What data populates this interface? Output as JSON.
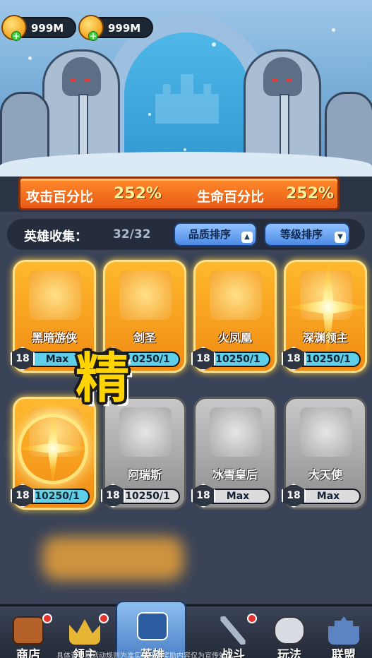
{
  "currency": [
    {
      "icon": "gold-gem-icon",
      "value": "999M"
    },
    {
      "icon": "gold-coin-icon",
      "value": "999M"
    }
  ],
  "stats": {
    "attack_label": "攻击百分比",
    "attack_value": "252%",
    "hp_label": "生命百分比",
    "hp_value": "252%"
  },
  "collection": {
    "label": "英雄收集：",
    "count": "32/32",
    "sort_quality": "品质排序",
    "sort_level": "等级排序"
  },
  "overlay_text": "精",
  "heroes": [
    {
      "name": "黑暗游侠",
      "level": "18",
      "progress_text": "Max",
      "rarity": "gold",
      "icon": "dark-ranger-icon",
      "progress": 1.0
    },
    {
      "name": "剑圣",
      "level": "18",
      "progress_text": "10250/1",
      "rarity": "gold",
      "icon": "sword-saint-icon",
      "progress": 1.0
    },
    {
      "name": "火凤凰",
      "level": "18",
      "progress_text": "10250/1",
      "rarity": "gold",
      "icon": "fire-phoenix-icon",
      "progress": 1.0
    },
    {
      "name": "深渊领主",
      "level": "18",
      "progress_text": "10250/1",
      "rarity": "gold",
      "icon": "abyss-lord-icon",
      "progress": 1.0
    },
    {
      "name": "",
      "level": "18",
      "progress_text": "10250/1",
      "rarity": "gold",
      "icon": "hero-icon",
      "progress": 1.0
    },
    {
      "name": "阿瑞斯",
      "level": "18",
      "progress_text": "10250/1",
      "rarity": "gray",
      "icon": "ares-icon",
      "progress": 1.0
    },
    {
      "name": "冰雪皇后",
      "level": "18",
      "progress_text": "Max",
      "rarity": "gray",
      "icon": "ice-queen-icon",
      "progress": 1.0
    },
    {
      "name": "大天使",
      "level": "18",
      "progress_text": "Max",
      "rarity": "gray",
      "icon": "archangel-icon",
      "progress": 1.0
    }
  ],
  "nav": [
    {
      "label": "商店",
      "icon": "shop-chest-icon",
      "badge": true
    },
    {
      "label": "领主",
      "icon": "crown-icon",
      "badge": true
    },
    {
      "label": "英雄",
      "icon": "hero-cards-icon",
      "badge": false
    },
    {
      "label": "战斗",
      "icon": "crossed-swords-icon",
      "badge": true
    },
    {
      "label": "玩法",
      "icon": "gamepad-icon",
      "badge": false
    },
    {
      "label": "联盟",
      "icon": "castle-icon",
      "badge": false
    }
  ],
  "disclaimer": "具体请参以活动规则为准实际任务奖励内容仅为宣传效果"
}
